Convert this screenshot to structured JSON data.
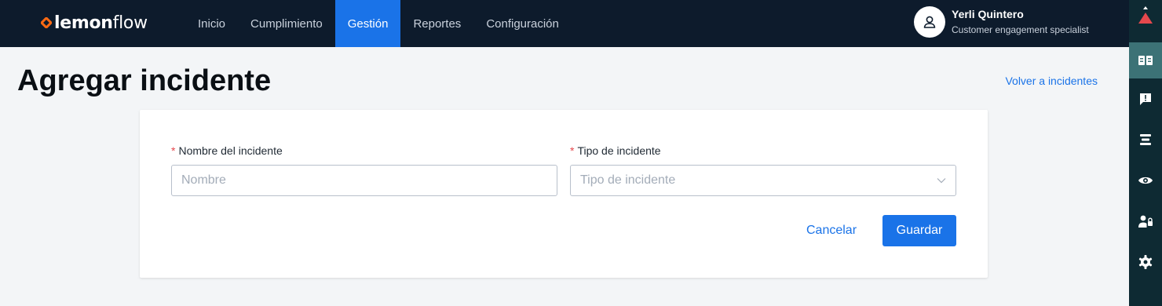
{
  "brand": {
    "logo_bold": "lemon",
    "logo_light": "flow",
    "logo_mark_color": "#ff6a13"
  },
  "nav": {
    "items": [
      {
        "label": "Inicio",
        "active": false
      },
      {
        "label": "Cumplimiento",
        "active": false
      },
      {
        "label": "Gestión",
        "active": true
      },
      {
        "label": "Reportes",
        "active": false
      },
      {
        "label": "Configuración",
        "active": false
      }
    ]
  },
  "user": {
    "name": "Yerli Quintero",
    "role": "Customer engagement specialist",
    "icon": "user-icon"
  },
  "page": {
    "title": "Agregar incidente",
    "back_link": "Volver a incidentes"
  },
  "form": {
    "name_field": {
      "required_mark": "*",
      "label": "Nombre del incidente",
      "value": "",
      "placeholder": "Nombre"
    },
    "type_field": {
      "required_mark": "*",
      "label": "Tipo de incidente",
      "value": "",
      "placeholder": "Tipo de incidente"
    },
    "cancel_label": "Cancelar",
    "save_label": "Guardar"
  },
  "right_rail": {
    "icons": [
      "alert-triangle-icon",
      "book-open-icon",
      "feedback-icon",
      "list-icon",
      "eye-icon",
      "user-lock-icon",
      "gear-icon"
    ],
    "active_index": 1
  },
  "colors": {
    "topbar": "#0d1b2c",
    "accent": "#1a73e8",
    "required": "#e5484d",
    "rail": "#0e2a33",
    "rail_active": "#3c7276"
  }
}
